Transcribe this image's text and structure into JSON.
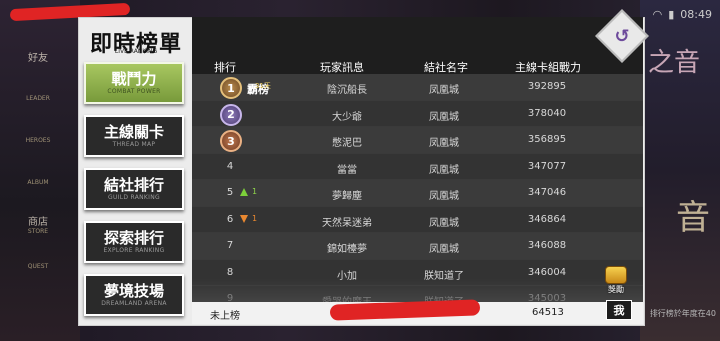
{
  "status": {
    "time": "08:49",
    "battery": "▮",
    "wifi": "wifi"
  },
  "left_nav": [
    {
      "label": "好友",
      "sub": ""
    },
    {
      "label": "",
      "sub": "LEADER"
    },
    {
      "label": "",
      "sub": "HEROES"
    },
    {
      "label": "",
      "sub": "ALBUM"
    },
    {
      "label": "商店",
      "sub": "STORE"
    },
    {
      "label": "",
      "sub": "QUEST"
    }
  ],
  "right_deco": {
    "big": "音",
    "big2": "之音",
    "notice": "排行榜於年度在40"
  },
  "logo": {
    "title": "即時榜單",
    "subtitle": "LIVE RANKING"
  },
  "tabs": [
    {
      "label": "戰鬥力",
      "en": "COMBAT POWER",
      "active": true
    },
    {
      "label": "主線關卡",
      "en": "THREAD MAP",
      "active": false
    },
    {
      "label": "結社排行",
      "en": "GUILD RANKING",
      "active": false
    },
    {
      "label": "探索排行",
      "en": "EXPLORE RANKING",
      "active": false
    },
    {
      "label": "夢境技場",
      "en": "DREAMLAND ARENA",
      "active": false
    }
  ],
  "header": {
    "rank": "排行",
    "player": "玩家訊息",
    "guild": "結社名字",
    "power": "主線卡組戰力"
  },
  "top_badge": {
    "label": "霸榜",
    "days": "31天"
  },
  "rows": [
    {
      "rank": "1",
      "name": "陰沉船長",
      "guild": "凤凰城",
      "power": "392895",
      "change": ""
    },
    {
      "rank": "2",
      "name": "大少爺",
      "guild": "凤凰城",
      "power": "378040",
      "change": ""
    },
    {
      "rank": "3",
      "name": "憋泥巴",
      "guild": "凤凰城",
      "power": "356895",
      "change": ""
    },
    {
      "rank": "4",
      "name": "當當",
      "guild": "凤凰城",
      "power": "347077",
      "change": ""
    },
    {
      "rank": "5",
      "name": "夢歸塵",
      "guild": "凤凰城",
      "power": "347046",
      "change": "1"
    },
    {
      "rank": "6",
      "name": "天然呆迷弟",
      "guild": "凤凰城",
      "power": "346864",
      "change": "1"
    },
    {
      "rank": "7",
      "name": "錦如檯夢",
      "guild": "凤凰城",
      "power": "346088",
      "change": ""
    },
    {
      "rank": "8",
      "name": "小加",
      "guild": "朕知道了",
      "power": "346004",
      "change": ""
    },
    {
      "rank": "9",
      "name": "愛哭的魔王",
      "guild": "朕知道了",
      "power": "345003",
      "change": ""
    }
  ],
  "me": {
    "rank": "未上榜",
    "power": "64513",
    "button": "我"
  },
  "reward": {
    "label": "獎勵"
  },
  "colors": {
    "active_tab": "#98b850",
    "up": "#7ccf3a",
    "down": "#e98830",
    "redact": "#e02424"
  }
}
